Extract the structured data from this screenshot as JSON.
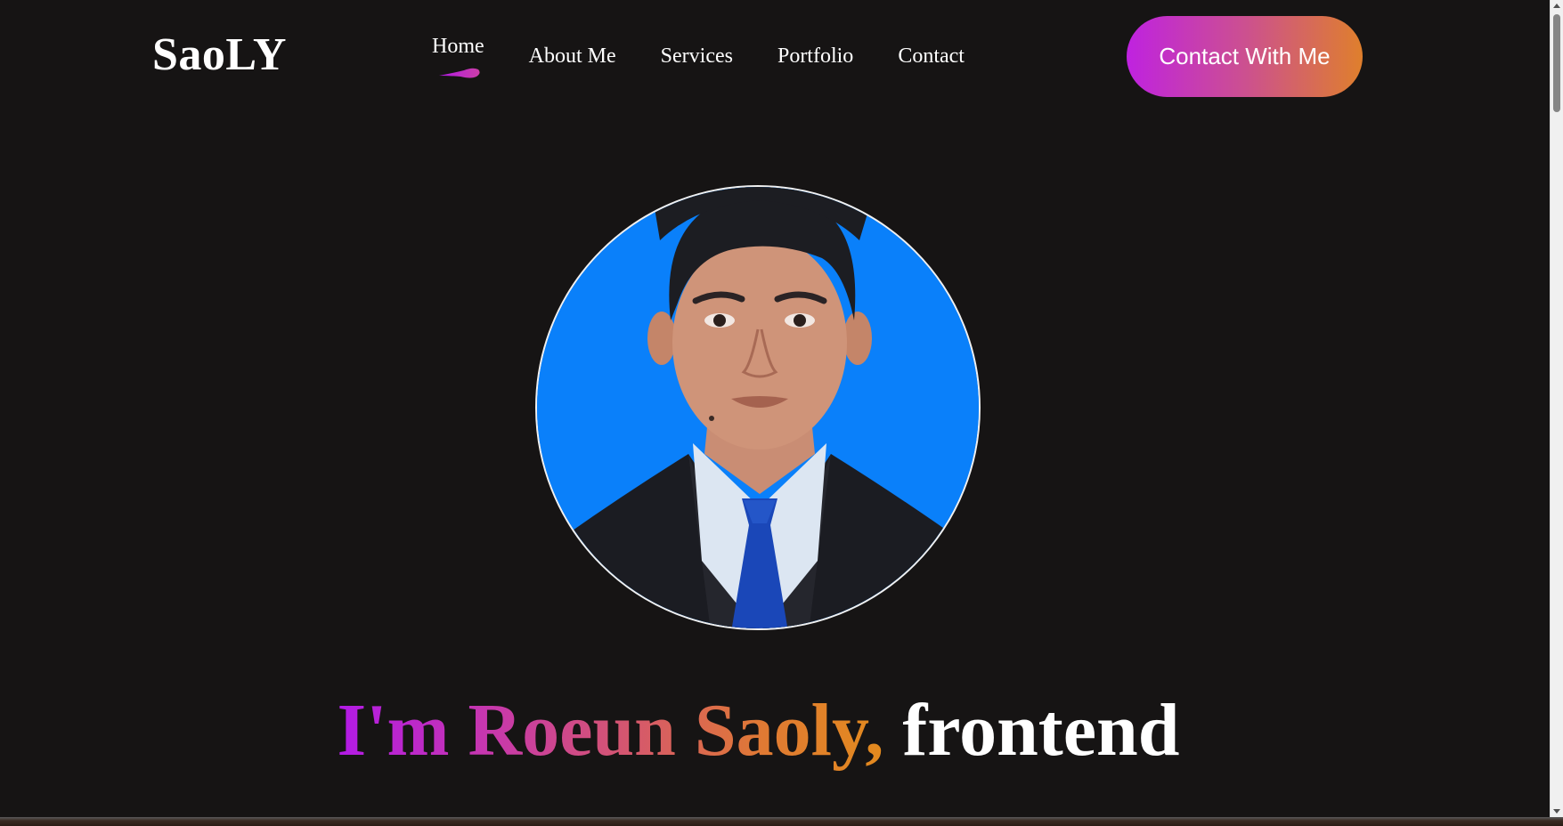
{
  "brand": {
    "logo_text": "SaoLY"
  },
  "nav": {
    "items": [
      {
        "label": "Home",
        "active": true
      },
      {
        "label": "About Me",
        "active": false
      },
      {
        "label": "Services",
        "active": false
      },
      {
        "label": "Portfolio",
        "active": false
      },
      {
        "label": "Contact",
        "active": false
      }
    ],
    "cta_label": "Contact With Me"
  },
  "hero": {
    "title_gradient": "I'm Roeun Saoly,",
    "title_plain": " frontend"
  },
  "colors": {
    "background": "#161414",
    "accent_purple": "#bf22e0",
    "accent_orange": "#df7f2c",
    "avatar_background": "#0a80fa"
  },
  "icons": {
    "active_indicator": "drop-underline-icon"
  }
}
